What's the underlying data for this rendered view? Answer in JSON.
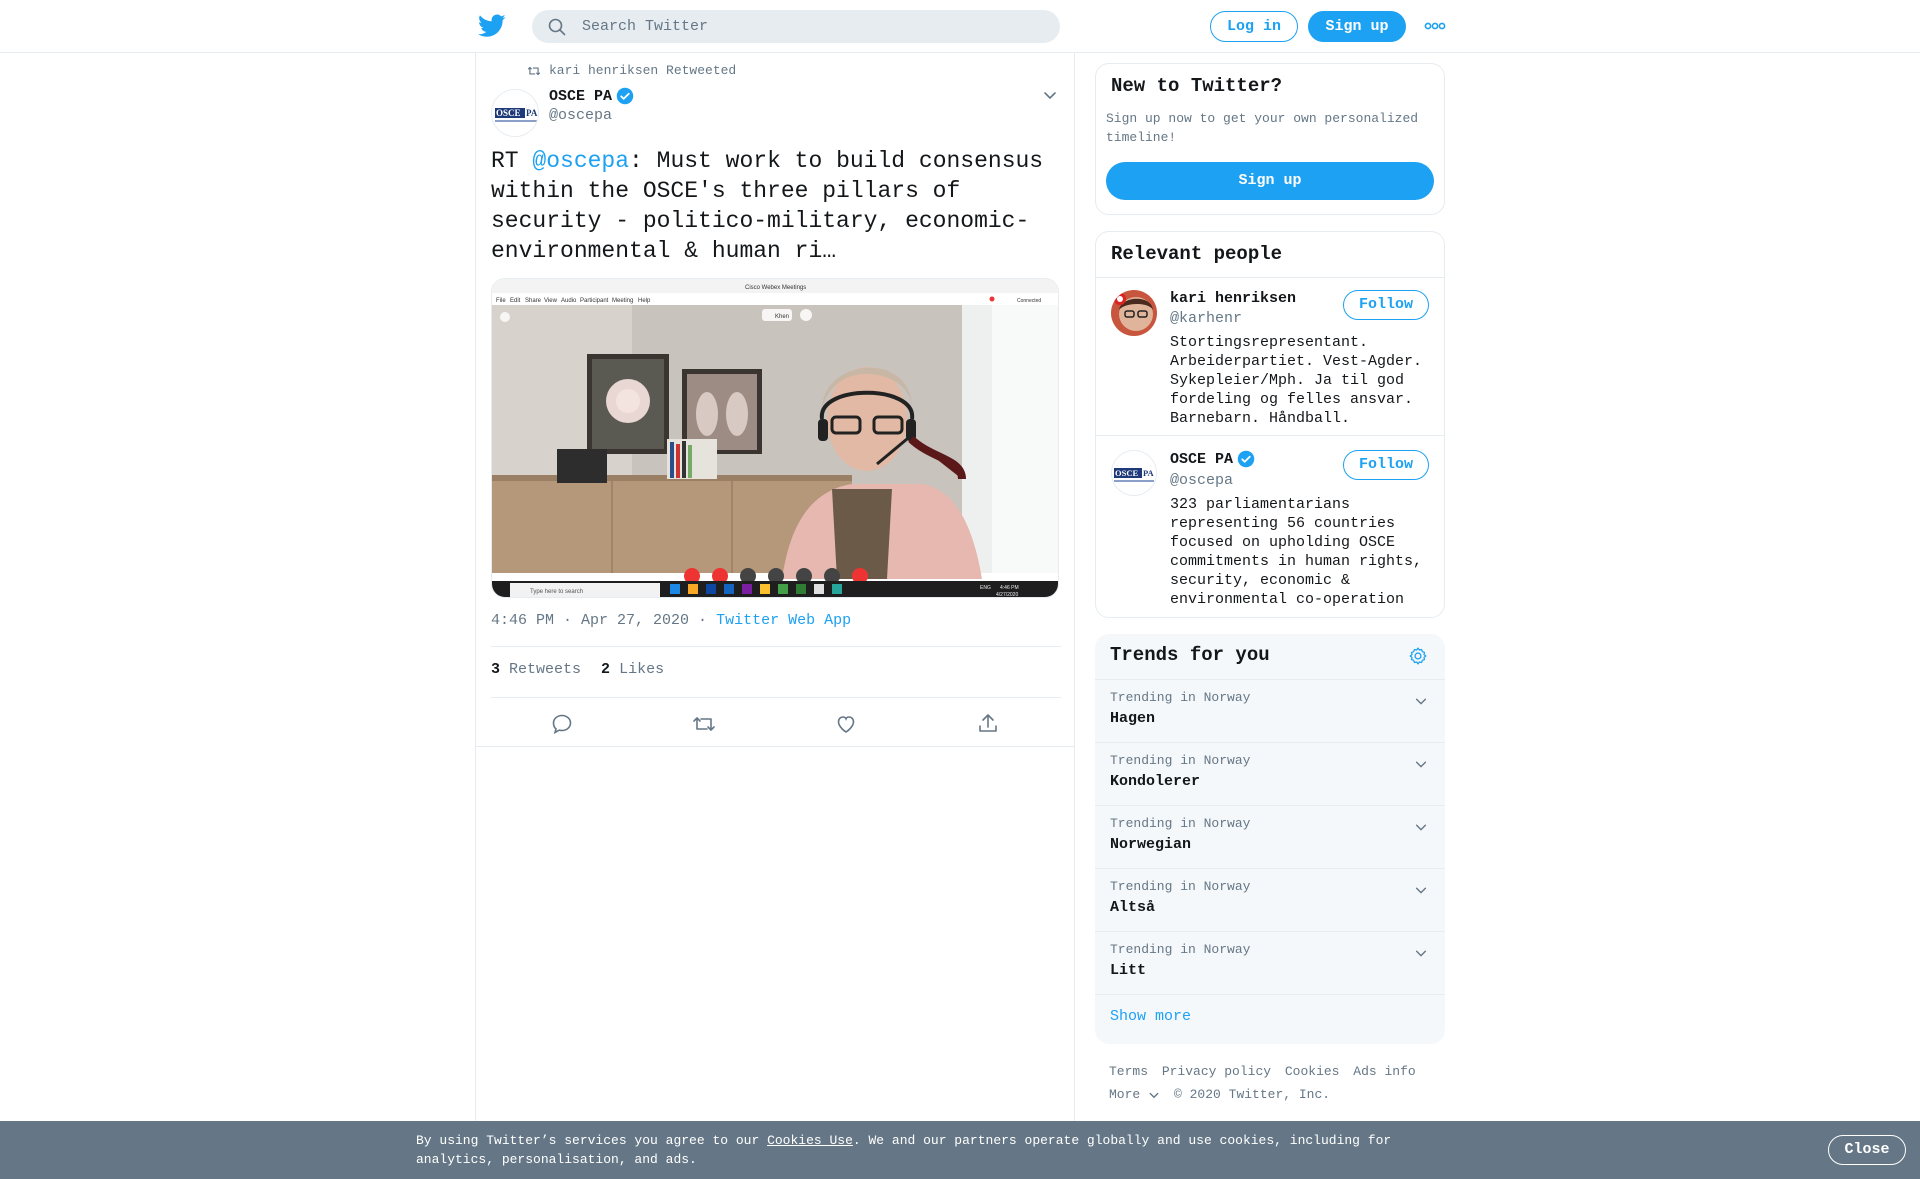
{
  "header": {
    "search_placeholder": "Search Twitter",
    "login_label": "Log in",
    "signup_label": "Sign up"
  },
  "tweet": {
    "retweeted_by": "kari henriksen Retweeted",
    "author_name": "OSCE PA",
    "author_handle": "@oscepa",
    "text_prefix": "RT ",
    "text_mention": "@oscepa",
    "text_body": ": Must work to build consensus within the OSCE's three pillars of security - politico-military, economic-environmental & human ri…",
    "time": "4:46 PM · Apr 27, 2020",
    "separator": " · ",
    "source": "Twitter Web App",
    "retweets_count": "3",
    "retweets_label": "Retweets",
    "likes_count": "2",
    "likes_label": "Likes",
    "media": {
      "window_title": "Cisco Webex Meetings",
      "menu": [
        "File",
        "Edit",
        "Share",
        "View",
        "Audio",
        "Participant",
        "Meeting",
        "Help"
      ],
      "connected": "Connected",
      "chip": "Khen",
      "taskbar_search": "Type here to search",
      "clock_time": "4:46 PM",
      "clock_date": "4/27/2020",
      "lang": "ENG"
    }
  },
  "new_to_twitter": {
    "title": "New to Twitter?",
    "subtitle": "Sign up now to get your own personalized timeline!",
    "button": "Sign up"
  },
  "relevant_people": {
    "title": "Relevant people",
    "people": [
      {
        "name": "kari henriksen",
        "handle": "@karhenr",
        "bio": "Stortingsrepresentant. Arbeiderpartiet. Vest-Agder. Sykepleier/Mph. Ja til god fordeling og felles ansvar. Barnebarn. Håndball.",
        "follow": "Follow"
      },
      {
        "name": "OSCE PA",
        "handle": "@oscepa",
        "bio": "323 parliamentarians representing 56 countries focused on upholding OSCE commitments in human rights, security, economic & environmental co-operation",
        "follow": "Follow"
      }
    ]
  },
  "trends": {
    "title": "Trends for you",
    "items": [
      {
        "label": "Trending in Norway",
        "name": "Hagen"
      },
      {
        "label": "Trending in Norway",
        "name": "Kondolerer"
      },
      {
        "label": "Trending in Norway",
        "name": "Norwegian"
      },
      {
        "label": "Trending in Norway",
        "name": "Altså"
      },
      {
        "label": "Trending in Norway",
        "name": "Litt"
      }
    ],
    "show_more": "Show more"
  },
  "footer": {
    "links": [
      "Terms",
      "Privacy policy",
      "Cookies",
      "Ads info"
    ],
    "more": "More",
    "copyright": "© 2020 Twitter, Inc."
  },
  "cookie_banner": {
    "text_before": "By using Twitter’s services you agree to our ",
    "link": "Cookies Use",
    "text_after": ". We and our partners operate globally and use cookies, including for analytics, personalisation, and ads.",
    "close": "Close"
  },
  "colors": {
    "accent": "#1da1f2",
    "text": "#14171a",
    "muted": "#657786",
    "border": "#e6ecf0",
    "banner": "#657786"
  },
  "icons": [
    "twitter-bird-icon",
    "search-icon",
    "more-dots-icon",
    "retweet-icon",
    "verified-icon",
    "chevron-down-icon",
    "reply-icon",
    "like-icon",
    "share-icon",
    "gear-icon"
  ]
}
